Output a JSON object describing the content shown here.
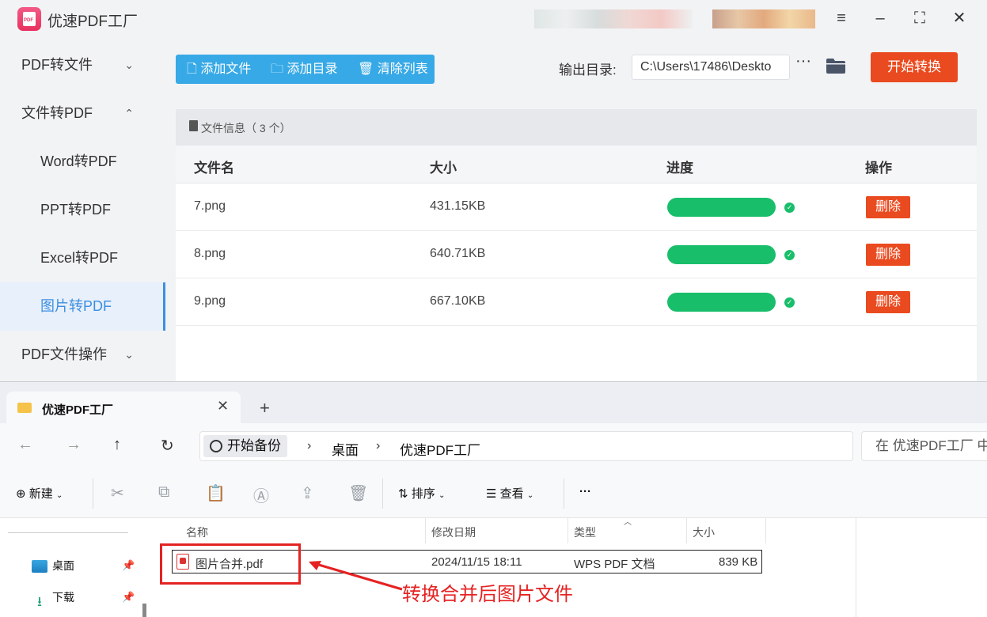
{
  "app": {
    "title": "优速PDF工厂",
    "logo_text": "PDF"
  },
  "sidebar": {
    "items": [
      {
        "label": "PDF转文件",
        "chevron": "⌄"
      },
      {
        "label": "文件转PDF",
        "chevron": "⌃"
      },
      {
        "label": "Word转PDF"
      },
      {
        "label": "PPT转PDF"
      },
      {
        "label": "Excel转PDF"
      },
      {
        "label": "图片转PDF"
      },
      {
        "label": "PDF文件操作",
        "chevron": "⌄"
      }
    ],
    "active_index": 5
  },
  "toolbar": {
    "add_file": "添加文件",
    "add_dir": "添加目录",
    "clear_list": "清除列表",
    "output_label": "输出目录:",
    "output_path": "C:\\Users\\17486\\Deskto",
    "more": "···",
    "start": "开始转换"
  },
  "file_panel": {
    "header": "文件信息（ 3 个）",
    "columns": [
      "文件名",
      "大小",
      "进度",
      "操作"
    ],
    "rows": [
      {
        "name": "7.png",
        "size": "431.15KB",
        "progress": 1.0,
        "action": "删除"
      },
      {
        "name": "8.png",
        "size": "640.71KB",
        "progress": 1.0,
        "action": "删除"
      },
      {
        "name": "9.png",
        "size": "667.10KB",
        "progress": 1.0,
        "action": "删除"
      }
    ]
  },
  "explorer": {
    "tab_title": "优速PDF工厂",
    "breadcrumb": [
      "开始备份",
      "桌面",
      "优速PDF工厂"
    ],
    "search_placeholder": "在 优速PDF工厂 中",
    "commands": {
      "new": "新建",
      "sort": "排序",
      "view": "查看",
      "more": "···"
    },
    "nav": [
      {
        "label": "桌面"
      },
      {
        "label": "下载"
      }
    ],
    "columns": [
      "名称",
      "修改日期",
      "类型",
      "大小"
    ],
    "files": [
      {
        "name": "图片合并.pdf",
        "modified": "2024/11/15 18:11",
        "type": "WPS PDF 文档",
        "size": "839 KB"
      }
    ],
    "annotation": "转换合并后图片文件"
  },
  "colors": {
    "accent_blue": "#37a9e6",
    "start_orange": "#ea4a1f",
    "progress_green": "#19be6b",
    "annotation_red": "#e52222"
  }
}
